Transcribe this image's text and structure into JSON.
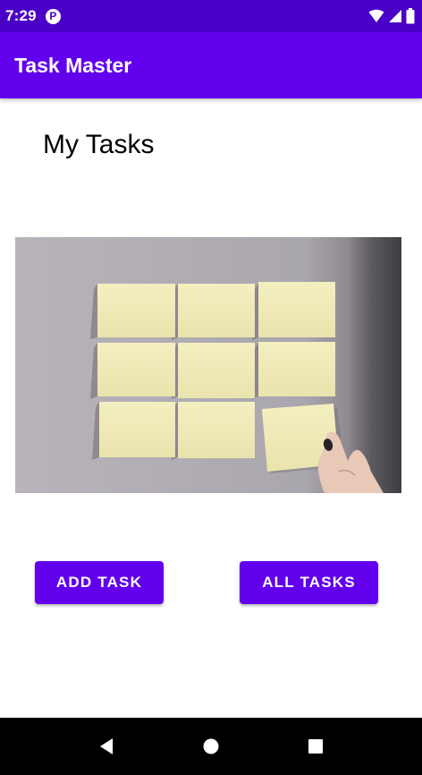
{
  "status_bar": {
    "time": "7:29",
    "app_icon_letter": "P",
    "icons": [
      "wifi-icon",
      "signal-icon",
      "battery-icon"
    ]
  },
  "app_bar": {
    "title": "Task Master"
  },
  "main": {
    "heading": "My Tasks",
    "image": {
      "subject": "sticky-notes-photo"
    },
    "buttons": {
      "add_task": "ADD TASK",
      "all_tasks": "ALL TASKS"
    }
  },
  "nav_bar": {
    "icons": [
      "back-icon",
      "home-icon",
      "recents-icon"
    ]
  },
  "colors": {
    "status_bar": "#4A00C7",
    "primary": "#6200EE",
    "nav_bar": "#000000"
  }
}
